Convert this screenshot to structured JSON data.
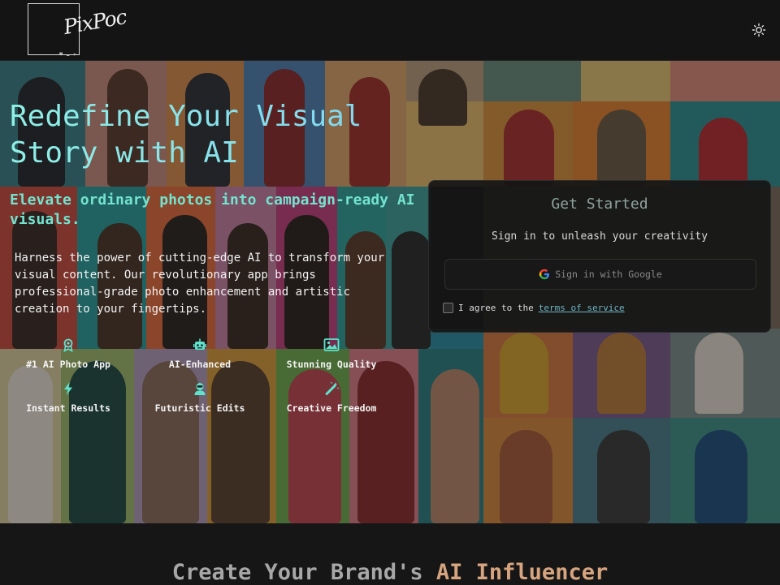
{
  "header": {
    "logo_text": "PixPoc",
    "logo_subtext": "♥ ☁ ✈",
    "theme_toggle_icon": "sun-icon"
  },
  "hero": {
    "title": "Redefine Your Visual Story with AI",
    "subtitle": "Elevate ordinary photos into campaign-ready AI visuals.",
    "description": "Harness the power of cutting-edge AI to transform your visual content. Our revolutionary app brings professional-grade photo enhancement and artistic creation to your fingertips.",
    "features": [
      {
        "label": "#1 AI Photo App",
        "icon": "award-icon"
      },
      {
        "label": "AI-Enhanced",
        "icon": "robot-icon"
      },
      {
        "label": "Stunning Quality",
        "icon": "image-icon"
      },
      {
        "label": "Instant Results",
        "icon": "lightning-icon"
      },
      {
        "label": "Futuristic Edits",
        "icon": "robot-face-icon"
      },
      {
        "label": "Creative Freedom",
        "icon": "magic-wand-icon"
      }
    ]
  },
  "signin_card": {
    "title": "Get Started",
    "subtitle": "Sign in to unleash your creativity",
    "google_button_label": "Sign in with Google",
    "agree_prefix": "I agree to the",
    "terms_link": "terms of service"
  },
  "bottom": {
    "heading_prefix": "Create Your Brand's",
    "heading_accent": "AI Influencer"
  },
  "colors": {
    "accent_teal": "#73e3cf",
    "accent_orange": "#d6a47e",
    "link": "#6fb4c2"
  }
}
